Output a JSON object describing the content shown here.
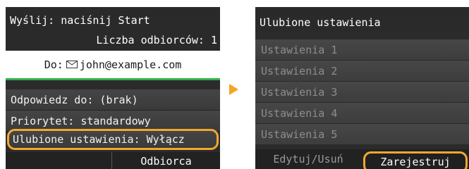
{
  "left_screen": {
    "header_line1": "Wyślij: naciśnij Start",
    "header_line2": "Liczba odbiorców: 1",
    "to_prefix": "Do:",
    "to_address": "john@example.com",
    "rows": [
      "Odpowiedz do: (brak)",
      "Priorytet: standardowy",
      "Ulubione ustawienia: Wyłącz"
    ],
    "bottom_button": "Odbiorca"
  },
  "right_screen": {
    "title": "Ulubione ustawienia",
    "items": [
      "Ustawienia 1",
      "Ustawienia 2",
      "Ustawienia 3",
      "Ustawienia 4",
      "Ustawienia 5"
    ],
    "edit_delete": "Edytuj/Usuń",
    "register": "Zarejestruj"
  },
  "colors": {
    "accent_orange": "#f0a830",
    "green_line": "#2fb34a",
    "screen_bg": "#2b2b2b"
  },
  "icons": {
    "mail": "mail-icon",
    "arrow": "arrow-right-icon"
  }
}
